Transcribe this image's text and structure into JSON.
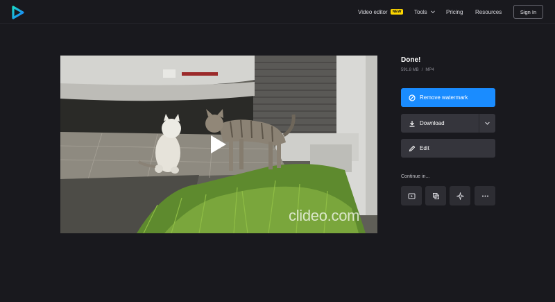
{
  "header": {
    "nav_video_editor": "Video editor",
    "badge_new": "NEW",
    "nav_tools": "Tools",
    "nav_pricing": "Pricing",
    "nav_resources": "Resources",
    "sign_in": "Sign In"
  },
  "video": {
    "watermark": "clideo.com"
  },
  "result": {
    "title": "Done!",
    "file_size": "591.8 MB",
    "separator": "/",
    "format": "MP4",
    "remove_watermark": "Remove watermark",
    "download": "Download",
    "edit": "Edit",
    "continue_label": "Continue in..."
  },
  "icons": {
    "logo": "play-logo-icon",
    "tools": [
      "video-player-icon",
      "copy-icon",
      "sparkle-icon",
      "more-dots-icon"
    ]
  },
  "colors": {
    "background": "#19191e",
    "accent": "#1a8cff",
    "button_dark": "#35353c",
    "badge": "#ffd800",
    "logo_start": "#1ad8c8",
    "logo_end": "#1a7cff"
  }
}
